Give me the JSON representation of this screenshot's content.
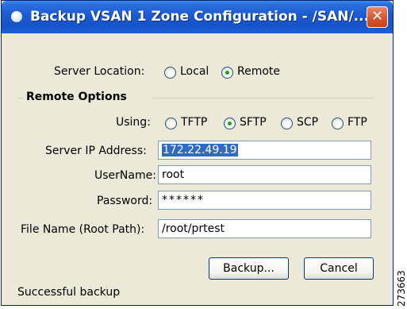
{
  "window": {
    "title": "Backup VSAN 1 Zone Configuration - /SAN/...",
    "close_glyph": "✕"
  },
  "server_location": {
    "label": "Server Location:",
    "options": [
      "Local",
      "Remote"
    ],
    "selected": "Remote"
  },
  "remote_options": {
    "group_title": "Remote Options",
    "using_label": "Using:",
    "protocols": [
      "TFTP",
      "SFTP",
      "SCP",
      "FTP"
    ],
    "selected_protocol": "SFTP"
  },
  "fields": {
    "server_ip_label": "Server IP Address:",
    "server_ip_value": "172.22.49.19",
    "username_label": "UserName:",
    "username_value": "root",
    "password_label": "Password:",
    "password_value": "******",
    "filename_label": "File Name (Root Path):",
    "filename_value": "/root/prtest"
  },
  "buttons": {
    "backup": "Backup...",
    "cancel": "Cancel"
  },
  "status": "Successful backup",
  "watermark": "273663",
  "icons": {
    "title": "window-app-icon",
    "close": "close-icon"
  },
  "colors": {
    "titlebar": "#1553c8",
    "window_bg": "#ece9d8",
    "selection": "#316ac5",
    "radio_dot": "#21a121",
    "close_button": "#d85a35"
  }
}
